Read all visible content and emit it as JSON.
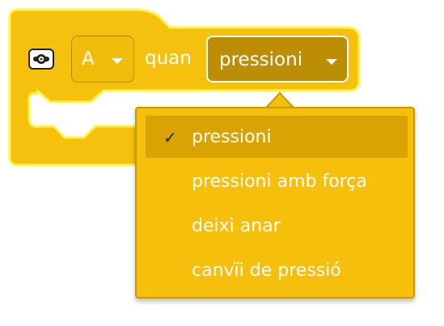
{
  "block": {
    "icon": "color-sensor-icon",
    "port_value": "A",
    "connector_text": "quan",
    "event_value": "pressioni"
  },
  "menu": {
    "items": [
      {
        "label": "pressioni",
        "selected": true,
        "check": "✓"
      },
      {
        "label": "pressioni amb força",
        "selected": false
      },
      {
        "label": "deixi anar",
        "selected": false
      },
      {
        "label": "canvïi de pressió",
        "selected": false
      }
    ]
  },
  "colors": {
    "block_fill": "#f5c10e",
    "block_outline": "#fff24a",
    "dropdown_active": "#bb8e05",
    "menu_fill": "#f5bf0c",
    "menu_selected": "#daa304"
  }
}
